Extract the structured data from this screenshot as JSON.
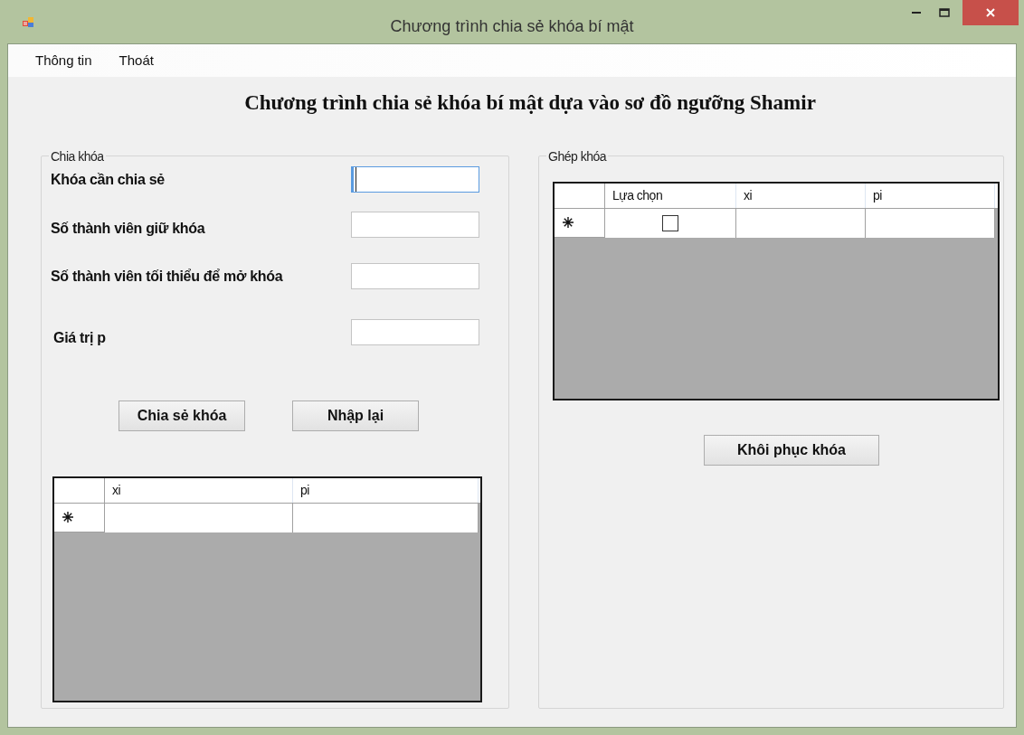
{
  "window": {
    "title": "Chương trình chia sẻ khóa bí mật"
  },
  "menu": [
    {
      "label": "Thông tin"
    },
    {
      "label": "Thoát"
    }
  ],
  "heading": "Chương trình chia sẻ khóa bí mật dựa vào sơ đồ ngưỡng Shamir",
  "share_group": {
    "title": "Chia khóa",
    "fields": [
      {
        "label": "Khóa cần chia sẻ",
        "focused": true
      },
      {
        "label": "Số thành viên giữ khóa",
        "focused": false
      },
      {
        "label": "Số thành viên tối thiểu để mở khóa",
        "focused": false
      },
      {
        "label": "Giá trị p",
        "focused": false
      }
    ],
    "buttons": [
      "Chia sẻ khóa",
      "Nhập lại"
    ],
    "table": {
      "columns": [
        "xi",
        "pi"
      ],
      "rows": [
        {
          "kind": "new"
        }
      ]
    }
  },
  "join_group": {
    "title": "Ghép khóa",
    "table": {
      "columns": [
        "Lựa chọn",
        "xi",
        "pi"
      ],
      "rows": [
        {
          "kind": "new",
          "checked": false
        }
      ]
    },
    "buttons": [
      "Khôi phục khóa"
    ]
  }
}
